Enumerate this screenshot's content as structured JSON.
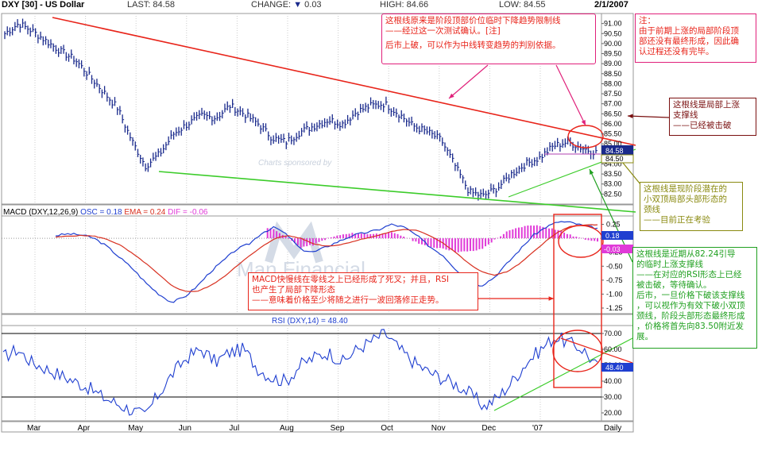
{
  "header": {
    "symbol": "DXY [30]",
    "name": "US Dollar",
    "last_label": "LAST:",
    "last": "84.58",
    "change_label": "CHANGE:",
    "change_arrow": "▼",
    "change": "0.03",
    "high_label": "HIGH:",
    "high": "84.66",
    "low_label": "LOW:",
    "low": "84.55",
    "date": "2/1/2007"
  },
  "panels": {
    "macd": {
      "prefix": "MACD (DXY,12,26,9)",
      "osc": "OSC = 0.18",
      "ema": "EMA = 0.24",
      "dif": "DIF = -0.06"
    },
    "rsi": {
      "title": "RSI (DXY,14) = 48.40"
    }
  },
  "watermark": {
    "sponsor": "Charts sponsored by",
    "brand": "Man Financial"
  },
  "price_labels": {
    "last_box": "84.58",
    "hline_box": "84.50"
  },
  "macd_labels": {
    "osc_box": "0.18",
    "dif_box": "-0.03"
  },
  "rsi_label_box": "48.40",
  "x_axis_labels": [
    "Mar",
    "Apr",
    "May",
    "Jun",
    "Jul",
    "Aug",
    "Sep",
    "Oct",
    "Nov",
    "Dec",
    "'07",
    "Daily"
  ],
  "annotations": {
    "top_center": [
      "这根线原来是阶段顶部价位临时下降趋势限制线",
      "——经过这一次测试确认。[注]",
      "",
      "后市上破，可以作为中线转变趋势的判别依据。"
    ],
    "top_right": [
      "注：",
      "由于前期上涨的局部阶段顶",
      "部还没有最终形成，因此确",
      "认过程还没有完毕。"
    ],
    "support": [
      "这根线是局部上涨",
      "支撑线",
      "——已经被击破"
    ],
    "neckline": [
      "这根线是现阶段潜在的",
      "小双顶局部头部形态的",
      "颈线",
      "——目前正在考验"
    ],
    "green_note": [
      "这根线是近期从82.24引导",
      "的临时上涨支撑线",
      "——在对应的RSI形态上已经",
      "被击破，等待确认。",
      "后市，一旦价格下破该支撑线",
      "，可以视作为有效下破小双顶",
      "颈线，阶段头部形态最终形成",
      "，价格将首先向83.50附近发",
      "展。"
    ],
    "macd_note": [
      "MACD快慢线在零线之上已经形成了死叉；并且，RSI",
      "也产生了局部下降形态",
      "——意味着价格至少将随之进行一波回落修正走势。"
    ]
  },
  "colors": {
    "price": "#1a2a8c",
    "resistance": "#e8241a",
    "support_long": "#3ccc2a",
    "macd_line": "#1f3fd0",
    "macd_signal": "#d83020",
    "macd_hist": "#e03ad8",
    "rsi_line": "#1f3fd0",
    "note_red": "#e8241a",
    "note_pink": "#e0207a",
    "note_brown": "#7a1010",
    "note_olive": "#8a8a10",
    "note_green": "#20a020",
    "callout_red": "#e8241a"
  },
  "chart_data": [
    {
      "type": "line",
      "title": "DXY [30] - US Dollar",
      "subtitle": "Daily",
      "x": [
        "Mar",
        "Apr",
        "May",
        "Jun",
        "Jul",
        "Aug",
        "Sep",
        "Oct",
        "Nov",
        "Dec",
        "'07"
      ],
      "ylim": [
        82.0,
        91.5
      ],
      "y_ticks": [
        "91.00",
        "90.50",
        "90.00",
        "89.50",
        "89.00",
        "88.50",
        "88.00",
        "87.50",
        "87.00",
        "86.50",
        "86.00",
        "85.50",
        "85.00",
        "84.50",
        "84.00",
        "83.50",
        "83.00",
        "82.50"
      ],
      "series": [
        {
          "values": [
            90.5,
            91.0,
            90.6,
            90.1,
            89.6,
            89.2,
            88.4,
            87.6,
            86.8,
            85.2,
            83.9,
            84.5,
            85.5,
            86.0,
            86.4,
            86.3,
            86.9,
            86.5,
            86.0,
            85.3,
            85.1,
            85.6,
            85.9,
            86.2,
            86.0,
            86.6,
            86.9,
            87.0,
            86.5,
            85.9,
            85.6,
            85.2,
            83.9,
            82.6,
            82.4,
            82.8,
            83.5,
            84.0,
            84.3,
            84.9,
            85.1,
            84.8,
            84.58
          ]
        }
      ],
      "trendlines": [
        "resistance",
        "support-long",
        "support-short",
        "neckline"
      ]
    },
    {
      "type": "line",
      "title": "MACD (DXY,12,26,9)",
      "ylim": [
        -1.35,
        0.4
      ],
      "y_ticks": [
        "0.25",
        "-0.25",
        "-0.50",
        "-0.75",
        "-1.00",
        "-1.25"
      ],
      "series": [
        {
          "name": "OSC",
          "values": [
            0.05,
            0.08,
            0.06,
            0.0,
            -0.15,
            -0.35,
            -0.55,
            -0.8,
            -1.0,
            -1.15,
            -1.05,
            -0.85,
            -0.6,
            -0.4,
            -0.2,
            -0.1,
            0.1,
            0.2,
            0.05,
            -0.2,
            -0.25,
            -0.15,
            -0.05,
            0.05,
            0.1,
            0.15,
            0.25,
            0.2,
            0.05,
            -0.15,
            -0.3,
            -0.55,
            -0.75,
            -0.85,
            -0.7,
            -0.45,
            -0.2,
            0.05,
            0.2,
            0.3,
            0.28,
            0.22,
            0.18
          ]
        },
        {
          "name": "EMA",
          "values": [
            0.02,
            0.04,
            0.05,
            0.04,
            -0.02,
            -0.12,
            -0.28,
            -0.45,
            -0.65,
            -0.85,
            -0.95,
            -0.95,
            -0.85,
            -0.7,
            -0.5,
            -0.32,
            -0.15,
            0.0,
            0.05,
            0.0,
            -0.1,
            -0.14,
            -0.12,
            -0.06,
            0.0,
            0.05,
            0.12,
            0.16,
            0.14,
            0.05,
            -0.08,
            -0.25,
            -0.45,
            -0.6,
            -0.66,
            -0.6,
            -0.45,
            -0.25,
            -0.05,
            0.12,
            0.22,
            0.24,
            0.24
          ]
        },
        {
          "name": "DIF",
          "values": [
            0.03,
            0.04,
            0.01,
            -0.04,
            -0.13,
            -0.23,
            -0.27,
            -0.35,
            -0.35,
            -0.3,
            -0.1,
            0.1,
            0.25,
            0.3,
            0.3,
            0.22,
            0.25,
            0.2,
            0.0,
            -0.2,
            -0.15,
            -0.01,
            0.07,
            0.11,
            0.1,
            0.1,
            0.13,
            0.04,
            -0.09,
            -0.2,
            -0.22,
            -0.3,
            -0.3,
            -0.25,
            -0.04,
            0.15,
            0.25,
            0.3,
            0.25,
            0.18,
            0.06,
            -0.02,
            -0.06
          ]
        }
      ]
    },
    {
      "type": "line",
      "title": "RSI (DXY,14)",
      "ylim": [
        15,
        75
      ],
      "y_ticks": [
        "70.00",
        "60.00",
        "50.00",
        "40.00",
        "30.00",
        "20.00"
      ],
      "series": [
        {
          "values": [
            55,
            60,
            52,
            48,
            44,
            40,
            36,
            30,
            26,
            22,
            18,
            32,
            45,
            55,
            60,
            52,
            58,
            60,
            48,
            42,
            40,
            50,
            55,
            58,
            52,
            60,
            65,
            70,
            60,
            52,
            46,
            42,
            38,
            32,
            24,
            30,
            40,
            52,
            60,
            68,
            64,
            60,
            48.4
          ]
        }
      ]
    }
  ]
}
